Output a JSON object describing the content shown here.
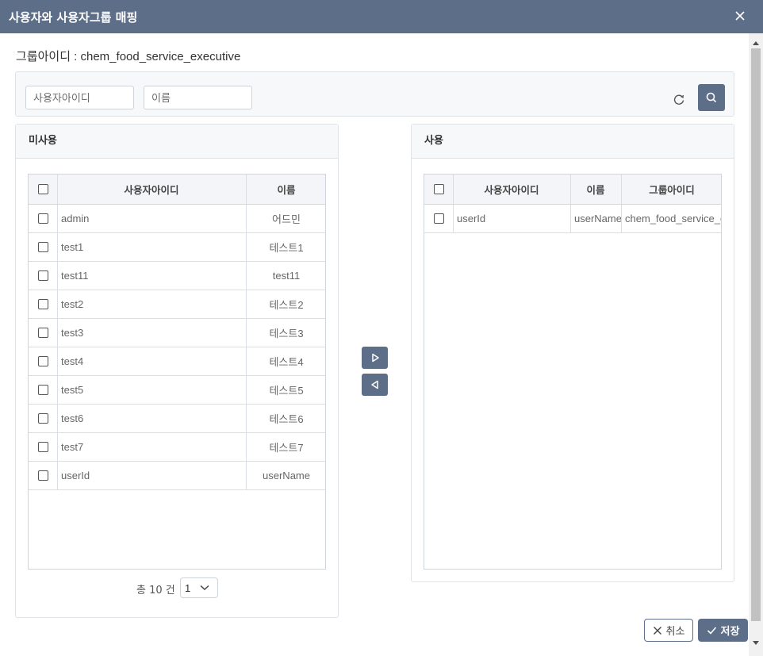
{
  "dialog": {
    "title": "사용자와 사용자그룹 매핑",
    "group_label": "그룹아이디 : chem_food_service_executive"
  },
  "search": {
    "user_id_placeholder": "사용자아이디",
    "name_placeholder": "이름"
  },
  "unused_panel": {
    "title": "미사용",
    "columns": [
      "사용자아이디",
      "이름"
    ],
    "rows": [
      {
        "id": "admin",
        "name": "어드민"
      },
      {
        "id": "test1",
        "name": "테스트1"
      },
      {
        "id": "test11",
        "name": "test11"
      },
      {
        "id": "test2",
        "name": "테스트2"
      },
      {
        "id": "test3",
        "name": "테스트3"
      },
      {
        "id": "test4",
        "name": "테스트4"
      },
      {
        "id": "test5",
        "name": "테스트5"
      },
      {
        "id": "test6",
        "name": "테스트6"
      },
      {
        "id": "test7",
        "name": "테스트7"
      },
      {
        "id": "userId",
        "name": "userName"
      }
    ],
    "total_text": "총 10 건",
    "page_value": "1"
  },
  "used_panel": {
    "title": "사용",
    "columns": [
      "사용자아이디",
      "이름",
      "그룹아이디"
    ],
    "rows": [
      {
        "id": "userId",
        "name": "userName",
        "group": "chem_food_service_executive"
      }
    ]
  },
  "footer": {
    "cancel_label": "취소",
    "save_label": "저장"
  },
  "colors": {
    "primary": "#5d6e88",
    "panel_bg": "#f7f8fa",
    "border": "#dfe3e8"
  }
}
